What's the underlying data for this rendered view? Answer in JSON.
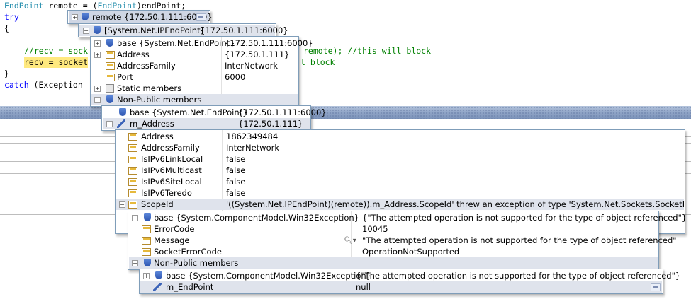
{
  "code": {
    "line1": {
      "type": "EndPoint",
      "mid": " remote = (",
      "type2": "EndPoint",
      "end": ")endPoint;"
    },
    "line2": "try",
    "line3": "{",
    "line5": {
      "comment_start": "//recv = sock",
      "comment_end": "remote); //this will block"
    },
    "line6": {
      "highlight": "recv = socket",
      "comment_end": "l block"
    },
    "line7": "}",
    "line8": {
      "kw": "catch",
      "rest": " (Exception "
    }
  },
  "tips": {
    "t1": {
      "rows": [
        {
          "name": "remote",
          "value": "{172.50.1.111:6000}"
        }
      ]
    },
    "t2": {
      "rows": [
        {
          "name": "[System.Net.IPEndPoint]",
          "value": "{172.50.1.111:6000}"
        }
      ]
    },
    "t3": {
      "rows": [
        {
          "name": "base {System.Net.EndPoint}",
          "value": "{172.50.1.111:6000}"
        },
        {
          "name": "Address",
          "value": "{172.50.1.111}"
        },
        {
          "name": "AddressFamily",
          "value": "InterNetwork"
        },
        {
          "name": "Port",
          "value": "6000"
        },
        {
          "name": "Static members",
          "value": ""
        },
        {
          "name": "Non-Public members",
          "value": ""
        }
      ]
    },
    "t4": {
      "rows": [
        {
          "name": "base {System.Net.EndPoint}",
          "value": "{172.50.1.111:6000}"
        },
        {
          "name": "m_Address",
          "value": "{172.50.1.111}"
        }
      ]
    },
    "t5": {
      "rows": [
        {
          "name": "Address",
          "value": "1862349484"
        },
        {
          "name": "AddressFamily",
          "value": "InterNetwork"
        },
        {
          "name": "IsIPv6LinkLocal",
          "value": "false"
        },
        {
          "name": "IsIPv6Multicast",
          "value": "false"
        },
        {
          "name": "IsIPv6SiteLocal",
          "value": "false"
        },
        {
          "name": "IsIPv6Teredo",
          "value": "false"
        },
        {
          "name": "ScopeId",
          "value": "'((System.Net.IPEndPoint)(remote)).m_Address.ScopeId' threw an exception of type 'System.Net.Sockets.SocketException'"
        }
      ]
    },
    "t6": {
      "rows": [
        {
          "name": "base {System.ComponentModel.Win32Exception}",
          "value": "{\"The attempted operation is not supported for the type of object referenced\"}"
        },
        {
          "name": "ErrorCode",
          "value": "10045"
        },
        {
          "name": "Message",
          "value": "\"The attempted operation is not supported for the type of object referenced\""
        },
        {
          "name": "SocketErrorCode",
          "value": "OperationNotSupported"
        },
        {
          "name": "Non-Public members",
          "value": ""
        }
      ]
    },
    "t7": {
      "rows": [
        {
          "name": "base {System.ComponentModel.Win32Exception}",
          "value": "{\"The attempted operation is not supported for the type of object referenced\"}"
        },
        {
          "name": "m_EndPoint",
          "value": "null"
        }
      ]
    }
  }
}
